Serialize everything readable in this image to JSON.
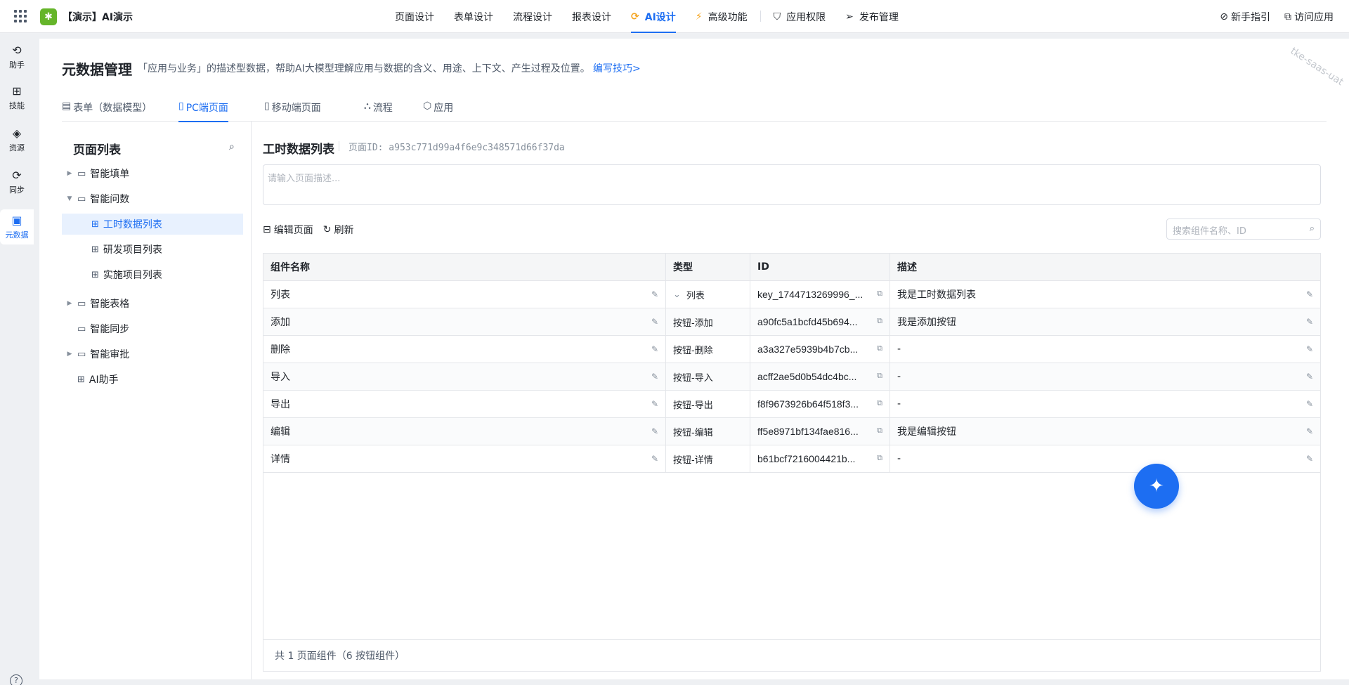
{
  "app": {
    "name": "【演示】AI演示",
    "logo_glyph": "✱",
    "brand_color": "#65b52a",
    "accent": "#1d6ef2"
  },
  "nav": {
    "items": [
      {
        "label": "页面设计"
      },
      {
        "label": "表单设计"
      },
      {
        "label": "流程设计"
      },
      {
        "label": "报表设计"
      },
      {
        "label": "AI设计",
        "icon": "ai-icon",
        "active": true
      },
      {
        "label": "高级功能",
        "icon": "magic-wand-icon"
      },
      {
        "label": "应用权限",
        "icon": "shield-icon"
      },
      {
        "label": "发布管理",
        "icon": "send-icon"
      }
    ],
    "guide": "新手指引",
    "visit": "访问应用"
  },
  "rail": {
    "items": [
      {
        "label": "助手",
        "icon": "assistant-icon"
      },
      {
        "label": "技能",
        "icon": "skills-icon"
      },
      {
        "label": "资源",
        "icon": "layers-icon"
      },
      {
        "label": "同步",
        "icon": "sync-icon"
      },
      {
        "label": "元数据",
        "icon": "metadata-icon",
        "active": true
      }
    ],
    "help": "?"
  },
  "header": {
    "title": "元数据管理",
    "description": "「应用与业务」的描述型数据，帮助AI大模型理解应用与数据的含义、用途、上下文、产生过程及位置。",
    "link": "编写技巧>",
    "watermark": "tke-saas-uat"
  },
  "tabs": [
    {
      "label": "表单（数据模型）",
      "icon": "form-icon"
    },
    {
      "label": "PC端页面",
      "icon": "page-icon",
      "active": true
    },
    {
      "label": "移动端页面",
      "icon": "page-icon"
    },
    {
      "label": "流程",
      "icon": "flow-icon"
    },
    {
      "label": "应用",
      "icon": "app-icon"
    }
  ],
  "tree": {
    "title": "页面列表",
    "items": [
      {
        "label": "智能填单",
        "type": "folder",
        "expanded": false
      },
      {
        "label": "智能问数",
        "type": "folder",
        "expanded": true
      },
      {
        "label": "工时数据列表",
        "type": "page",
        "selected": true
      },
      {
        "label": "研发项目列表",
        "type": "page"
      },
      {
        "label": "实施项目列表",
        "type": "page"
      },
      {
        "label": "智能表格",
        "type": "folder",
        "expanded": false
      },
      {
        "label": "智能同步",
        "type": "folder"
      },
      {
        "label": "智能审批",
        "type": "folder",
        "expanded": false
      },
      {
        "label": "AI助手",
        "type": "page"
      }
    ]
  },
  "page": {
    "title": "工时数据列表",
    "id_label": "页面ID: a953c771d99a4f6e9c348571d66f37da",
    "desc_placeholder": "请输入页面描述...",
    "edit_btn": "编辑页面",
    "refresh_btn": "刷新",
    "search_placeholder": "搜索组件名称、ID"
  },
  "table": {
    "headers": [
      "组件名称",
      "类型",
      "ID",
      "描述"
    ],
    "rows": [
      {
        "name": "列表",
        "type": "列表",
        "type_expand": true,
        "id": "key_1744713269996_...",
        "desc": "我是工时数据列表"
      },
      {
        "name": "添加",
        "type": "按钮-添加",
        "id": "a90fc5a1bcfd45b694...",
        "desc": "我是添加按钮"
      },
      {
        "name": "删除",
        "type": "按钮-删除",
        "id": "a3a327e5939b4b7cb...",
        "desc": "-"
      },
      {
        "name": "导入",
        "type": "按钮-导入",
        "id": "acff2ae5d0b54dc4bc...",
        "desc": "-"
      },
      {
        "name": "导出",
        "type": "按钮-导出",
        "id": "f8f9673926b64f518f3...",
        "desc": "-"
      },
      {
        "name": "编辑",
        "type": "按钮-编辑",
        "id": "ff5e8971bf134fae816...",
        "desc": "我是编辑按钮"
      },
      {
        "name": "详情",
        "type": "按钮-详情",
        "id": "b61bcf7216004421b...",
        "desc": "-"
      }
    ],
    "footer": "共 1 页面组件（6 按钮组件）"
  }
}
